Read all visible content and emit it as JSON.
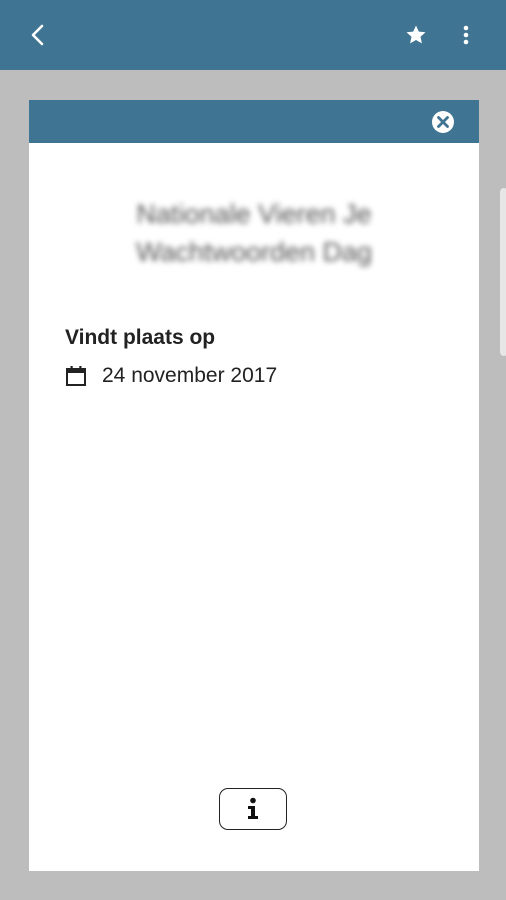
{
  "app_bar": {
    "back_icon": "chevron-left-icon",
    "favorite_icon": "star-icon",
    "more_icon": "more-vertical-icon"
  },
  "card": {
    "close_icon": "close-circle-icon",
    "event_title": "Nationale Vieren Je Wachtwoorden Dag",
    "occurs_label": "Vindt plaats op",
    "calendar_icon": "calendar-icon",
    "date": "24 november 2017",
    "info_icon": "info-icon"
  },
  "colors": {
    "primary": "#3f7592",
    "background": "#bdbdbd",
    "card": "#ffffff",
    "text": "#222222"
  }
}
